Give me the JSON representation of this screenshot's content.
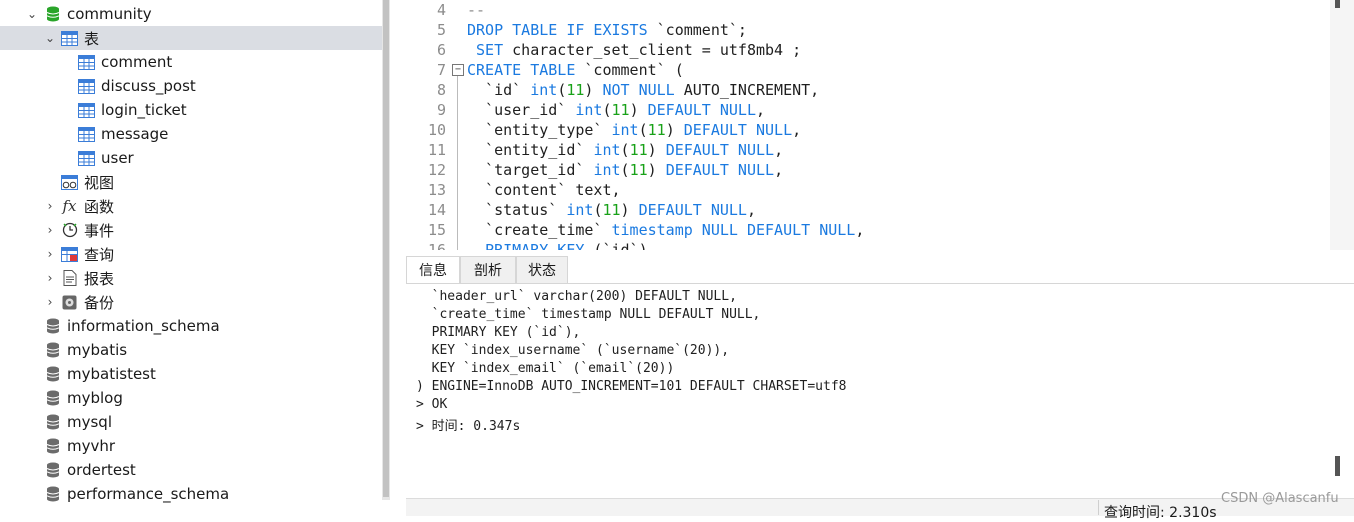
{
  "tree": {
    "db_active": "community",
    "group_tables": "表",
    "tables": [
      "comment",
      "discuss_post",
      "login_ticket",
      "message",
      "user"
    ],
    "group_views": "视图",
    "group_functions": "函数",
    "group_events": "事件",
    "group_queries": "查询",
    "group_reports": "报表",
    "group_backups": "备份",
    "databases": [
      "information_schema",
      "mybatis",
      "mybatistest",
      "myblog",
      "mysql",
      "myvhr",
      "ordertest",
      "performance_schema"
    ]
  },
  "editor": {
    "line_numbers": [
      "4",
      "5",
      "6",
      "7",
      "8",
      "9",
      "10",
      "11",
      "12",
      "13",
      "14",
      "15",
      "16"
    ],
    "lines": {
      "l4": "--",
      "l5a": "DROP TABLE IF EXISTS",
      "l5b": " `comment`;",
      "l6a": " SET",
      "l6b": " character_set_client = utf8mb4 ;",
      "l7a": "CREATE TABLE",
      "l7b": " `comment` (",
      "l8a": "  `id` ",
      "l8b": "int",
      "l8c": "(",
      "l8d": "11",
      "l8e": ") ",
      "l8f": "NOT NULL",
      "l8g": " AUTO_INCREMENT,",
      "l9a": "  `user_id` ",
      "l9b": "int",
      "l9c": "(",
      "l9d": "11",
      "l9e": ") ",
      "l9f": "DEFAULT NULL",
      "l9g": ",",
      "l10a": "  `entity_type` ",
      "l10b": "int",
      "l10c": "(",
      "l10d": "11",
      "l10e": ") ",
      "l10f": "DEFAULT NULL",
      "l10g": ",",
      "l11a": "  `entity_id` ",
      "l11b": "int",
      "l11c": "(",
      "l11d": "11",
      "l11e": ") ",
      "l11f": "DEFAULT NULL",
      "l11g": ",",
      "l12a": "  `target_id` ",
      "l12b": "int",
      "l12c": "(",
      "l12d": "11",
      "l12e": ") ",
      "l12f": "DEFAULT NULL",
      "l12g": ",",
      "l13a": "  `content` text,",
      "l14a": "  `status` ",
      "l14b": "int",
      "l14c": "(",
      "l14d": "11",
      "l14e": ") ",
      "l14f": "DEFAULT NULL",
      "l14g": ",",
      "l15a": "  `create_time` ",
      "l15b": "timestamp NULL DEFAULT NULL",
      "l15c": ",",
      "l16a": "  PRIMARY KEY",
      "l16b": " (`id`)"
    }
  },
  "tabs": [
    "信息",
    "剖析",
    "状态"
  ],
  "output_lines": [
    "  `header_url` varchar(200) DEFAULT NULL,",
    "  `create_time` timestamp NULL DEFAULT NULL,",
    "  PRIMARY KEY (`id`),",
    "  KEY `index_username` (`username`(20)),",
    "  KEY `index_email` (`email`(20))",
    ") ENGINE=InnoDB AUTO_INCREMENT=101 DEFAULT CHARSET=utf8",
    "> OK",
    "> 时间: 0.347s"
  ],
  "status": {
    "query_time": "查询时间: 2.310s"
  },
  "watermark": "CSDN @Alascanfu",
  "colors": {
    "keyword": "#1b7ae0",
    "number": "#18a118",
    "selected_row": "#dadde3",
    "db_icon_green": "#2aa52a"
  }
}
